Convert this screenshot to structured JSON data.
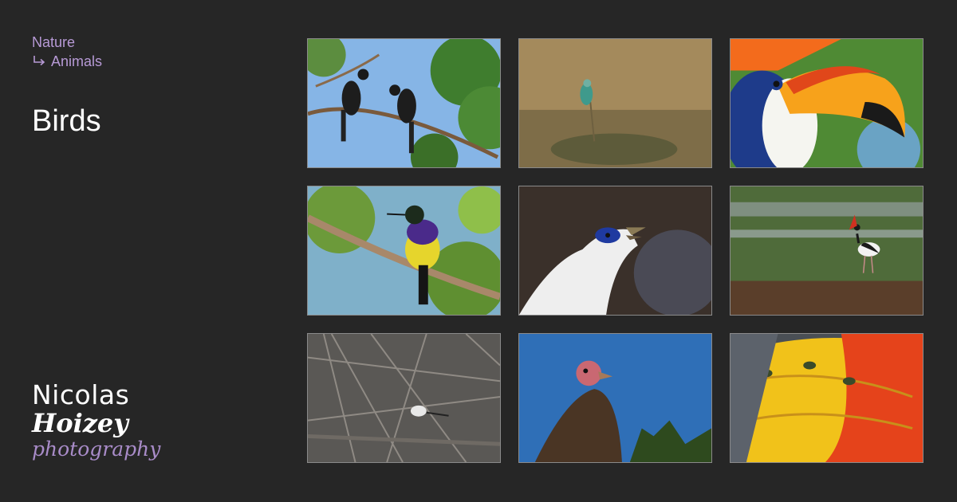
{
  "breadcrumb": {
    "parent": "Nature",
    "current": "Animals",
    "arrow_icon": "return-arrow-icon"
  },
  "page": {
    "title": "Birds"
  },
  "logo": {
    "line1": "Nicolas",
    "line2": "Hoizey",
    "line3": "photography"
  },
  "colors": {
    "background": "#262626",
    "accent": "#b79ad6",
    "title": "#ffffff",
    "tile_border": "#8a8a8a"
  },
  "gallery": {
    "photos": [
      {
        "subject": "two-birds-on-branch-photo"
      },
      {
        "subject": "roller-in-grass-photo"
      },
      {
        "subject": "toucan-photo"
      },
      {
        "subject": "sunbird-on-branch-photo"
      },
      {
        "subject": "white-bird-portrait-photo"
      },
      {
        "subject": "stork-in-marsh-photo"
      },
      {
        "subject": "small-bird-in-bare-branches-photo"
      },
      {
        "subject": "vulture-photo"
      },
      {
        "subject": "parrot-feathers-photo"
      }
    ]
  }
}
